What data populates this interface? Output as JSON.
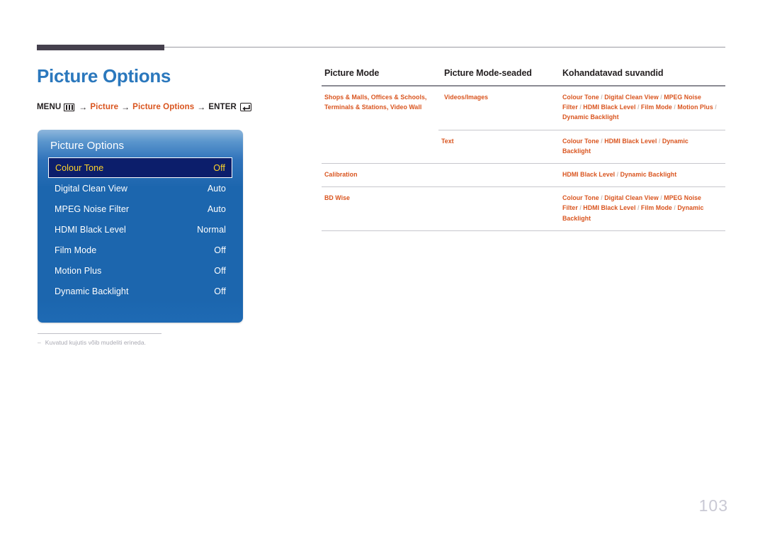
{
  "page": {
    "title": "Picture Options",
    "page_number": "103"
  },
  "menu_path": {
    "menu_label": "MENU",
    "menu_icon": "menu-grid-icon",
    "arrow": "→",
    "step1": "Picture",
    "step2": "Picture Options",
    "enter_label": "ENTER",
    "enter_icon": "enter-key-icon"
  },
  "osd": {
    "title": "Picture Options",
    "rows": [
      {
        "label": "Colour Tone",
        "value": "Off",
        "selected": true
      },
      {
        "label": "Digital Clean View",
        "value": "Auto",
        "selected": false
      },
      {
        "label": "MPEG Noise Filter",
        "value": "Auto",
        "selected": false
      },
      {
        "label": "HDMI Black Level",
        "value": "Normal",
        "selected": false
      },
      {
        "label": "Film Mode",
        "value": "Off",
        "selected": false
      },
      {
        "label": "Motion Plus",
        "value": "Off",
        "selected": false
      },
      {
        "label": "Dynamic Backlight",
        "value": "Off",
        "selected": false
      }
    ]
  },
  "footnote": {
    "dash": "–",
    "text": "Kuvatud kujutis võib mudeliti erineda."
  },
  "table": {
    "headers": [
      "Picture Mode",
      "Picture Mode-seaded",
      "Kohandatavad suvandid"
    ],
    "rows": [
      {
        "picture_mode": "Shops & Malls, Offices & Schools, Terminals & Stations, Video Wall",
        "sub_rows": [
          {
            "mode": "Videos/Images",
            "options": "Colour Tone / Digital Clean View / MPEG Noise Filter / HDMI Black Level / Film Mode / Motion Plus / Dynamic Backlight"
          },
          {
            "mode": "Text",
            "options": "Colour Tone / HDMI Black Level / Dynamic Backlight"
          }
        ]
      },
      {
        "picture_mode": "Calibration",
        "sub_rows": [
          {
            "mode": "",
            "options": "HDMI Black Level / Dynamic Backlight"
          }
        ]
      },
      {
        "picture_mode": "BD Wise",
        "sub_rows": [
          {
            "mode": "",
            "options": "Colour Tone / Digital Clean View / MPEG Noise Filter / HDMI Black Level / Film Mode / Dynamic Backlight"
          }
        ]
      }
    ]
  },
  "colors": {
    "title_blue": "#2b78bd",
    "accent_orange": "#d9541e",
    "osd_blue": "#1c66ae",
    "osd_selected_bg": "#0c1e6b",
    "osd_selected_text": "#ffd42a",
    "rule_dark": "#45404d"
  }
}
